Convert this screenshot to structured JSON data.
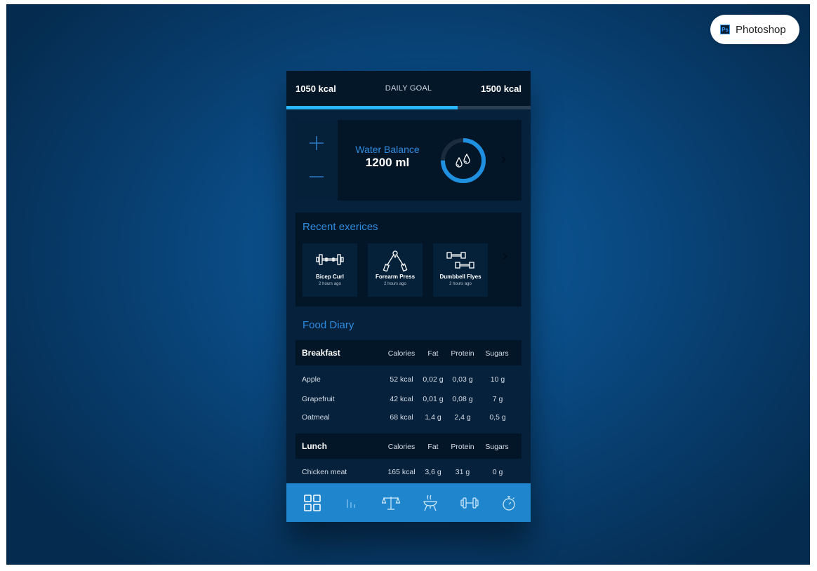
{
  "badge": {
    "icon_text": "Ps",
    "label": "Photoshop"
  },
  "goal": {
    "current": "1050 kcal",
    "title": "DAILY GOAL",
    "target": "1500 kcal",
    "progress_fraction": 0.7,
    "bar_color": "#29b6ff"
  },
  "water": {
    "title": "Water Balance",
    "value": "1200 ml",
    "ring_fraction": 0.75,
    "plus_icon": "plus-icon",
    "minus_icon": "minus-icon"
  },
  "exercises": {
    "title": "Recent exerices",
    "items": [
      {
        "name": "Bicep Curl",
        "time": "2 hours ago",
        "icon": "barbell-icon"
      },
      {
        "name": "Forearm Press",
        "time": "2 hours ago",
        "icon": "hand-gripper-icon"
      },
      {
        "name": "Dumbbell Flyes",
        "time": "2 hours ago",
        "icon": "dumbbells-icon"
      }
    ]
  },
  "food": {
    "title": "Food Diary",
    "columns": [
      "Calories",
      "Fat",
      "Protein",
      "Sugars"
    ],
    "meals": [
      {
        "name": "Breakfast",
        "rows": [
          {
            "item": "Apple",
            "calories": "52 kcal",
            "fat": "0,02 g",
            "protein": "0,03 g",
            "sugars": "10 g"
          },
          {
            "item": "Grapefruit",
            "calories": "42 kcal",
            "fat": "0,01 g",
            "protein": "0,08 g",
            "sugars": "7 g"
          },
          {
            "item": "Oatmeal",
            "calories": "68 kcal",
            "fat": "1,4 g",
            "protein": "2,4 g",
            "sugars": "0,5 g"
          }
        ]
      },
      {
        "name": "Lunch",
        "rows": [
          {
            "item": "Chicken meat",
            "calories": "165 kcal",
            "fat": "3,6 g",
            "protein": "31 g",
            "sugars": "0 g"
          }
        ]
      }
    ]
  },
  "tabs": [
    "dashboard-icon",
    "stats-icon",
    "scale-icon",
    "food-icon",
    "dumbbell-icon",
    "stopwatch-icon"
  ],
  "colors": {
    "accent": "#2e8ce0",
    "tabbar": "#1f86ce",
    "panel": "#031628",
    "background": "#05213b"
  }
}
